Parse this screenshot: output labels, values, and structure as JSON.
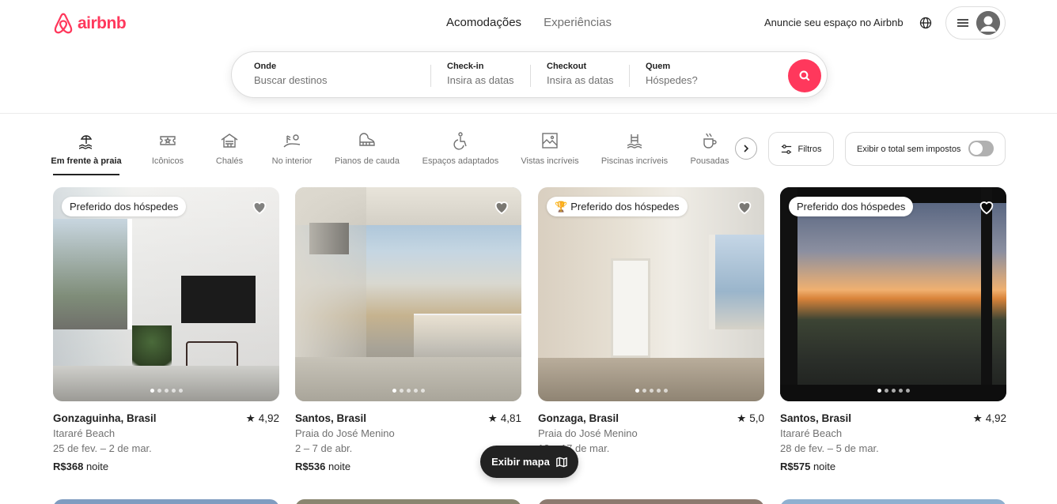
{
  "header": {
    "logo_text": "airbnb",
    "tabs": [
      {
        "label": "Acomodações"
      },
      {
        "label": "Experiências"
      }
    ],
    "host_link": "Anuncie seu espaço no Airbnb"
  },
  "search": {
    "where": {
      "title": "Onde",
      "value": "Buscar destinos"
    },
    "checkin": {
      "title": "Check-in",
      "value": "Insira as datas"
    },
    "checkout": {
      "title": "Checkout",
      "value": "Insira as datas"
    },
    "who": {
      "title": "Quem",
      "value": "Hóspedes?"
    }
  },
  "categories": [
    {
      "label": "Em frente à praia",
      "icon": "beach-icon"
    },
    {
      "label": "Icônicos",
      "icon": "ticket-star-icon"
    },
    {
      "label": "Chalés",
      "icon": "cabin-icon"
    },
    {
      "label": "No interior",
      "icon": "countryside-icon"
    },
    {
      "label": "Pianos de cauda",
      "icon": "piano-icon"
    },
    {
      "label": "Espaços adaptados",
      "icon": "accessible-icon"
    },
    {
      "label": "Vistas incríveis",
      "icon": "view-icon"
    },
    {
      "label": "Piscinas incríveis",
      "icon": "pool-icon"
    },
    {
      "label": "Pousadas",
      "icon": "coffee-icon"
    }
  ],
  "filters": {
    "label": "Filtros"
  },
  "tax_toggle": {
    "label": "Exibir o total sem impostos",
    "on": false
  },
  "listings": [
    {
      "badge": "Preferido dos hóspedes",
      "title": "Gonzaguinha, Brasil",
      "rating": "4,92",
      "subtitle": "Itararé Beach",
      "dates": "25 de fev. – 2 de mar.",
      "price": "R$368",
      "price_unit": "noite"
    },
    {
      "badge": "",
      "title": "Santos, Brasil",
      "rating": "4,81",
      "subtitle": "Praia do José Menino",
      "dates": "2 – 7 de abr.",
      "price": "R$536",
      "price_unit": "noite"
    },
    {
      "badge": "Preferido dos hóspedes",
      "title": "Gonzaga, Brasil",
      "rating": "5,0",
      "subtitle": "Praia do José Menino",
      "dates": "12 – 17 de mar.",
      "price": "",
      "price_unit": "noite"
    },
    {
      "badge": "Preferido dos hóspedes",
      "title": "Santos, Brasil",
      "rating": "4,92",
      "subtitle": "Itararé Beach",
      "dates": "28 de fev. – 5 de mar.",
      "price": "R$575",
      "price_unit": "noite"
    }
  ],
  "map_button": {
    "label": "Exibir mapa"
  },
  "colors": {
    "brand": "#ff385c",
    "text": "#222222",
    "muted": "#717171"
  }
}
